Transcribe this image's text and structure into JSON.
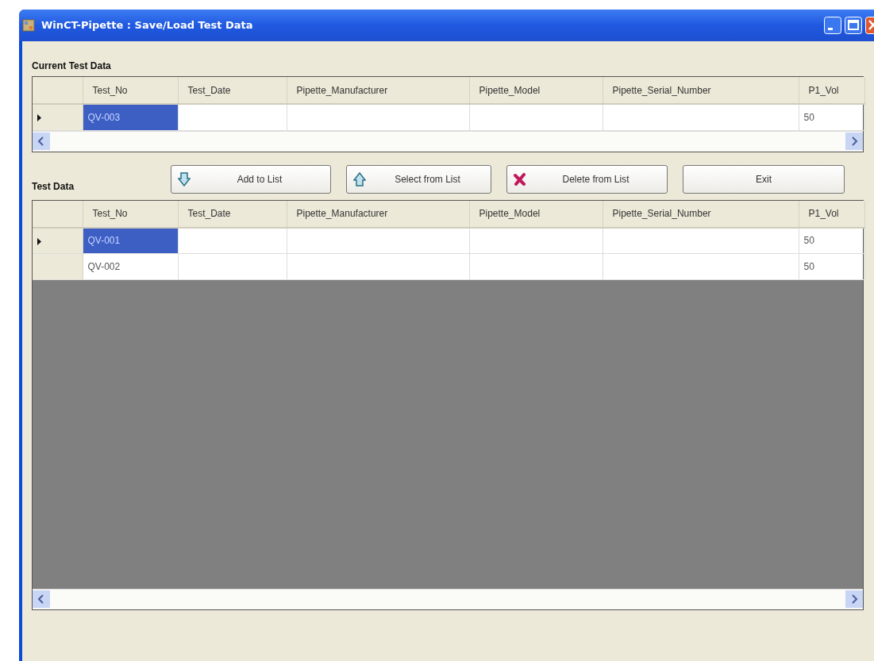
{
  "window": {
    "title": "WinCT-Pipette : Save/Load Test Data"
  },
  "current_grid": {
    "label": "Current Test Data",
    "columns": [
      "Test_No",
      "Test_Date",
      "Pipette_Manufacturer",
      "Pipette_Model",
      "Pipette_Serial_Number",
      "P1_Vol"
    ],
    "rows": [
      {
        "selected": true,
        "cells": [
          "QV-003",
          "",
          "",
          "",
          "",
          "50"
        ]
      }
    ]
  },
  "buttons": [
    {
      "label": "Add to List",
      "kind": "add"
    },
    {
      "label": "Select from List",
      "kind": "select"
    },
    {
      "label": "Delete from List",
      "kind": "delete"
    },
    {
      "label": "Exit",
      "kind": "plain"
    }
  ],
  "list_grid": {
    "label": "Test Data",
    "columns": [
      "Test_No",
      "Test_Date",
      "Pipette_Manufacturer",
      "Pipette_Model",
      "Pipette_Serial_Number",
      "P1_Vol"
    ],
    "rows": [
      {
        "selected": true,
        "cells": [
          "QV-001",
          "",
          "",
          "",
          "",
          "50"
        ]
      },
      {
        "selected": false,
        "cells": [
          "QV-002",
          "",
          "",
          "",
          "",
          "50"
        ]
      }
    ]
  }
}
